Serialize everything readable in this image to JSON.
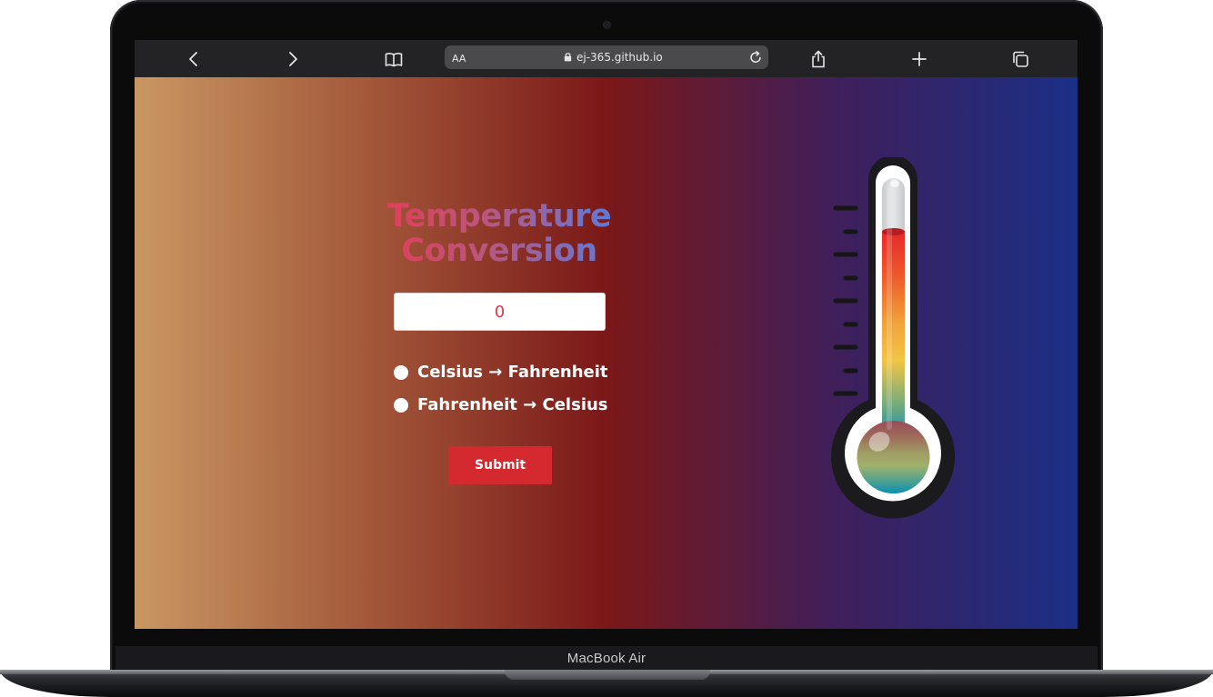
{
  "device": {
    "model_label": "MacBook Air"
  },
  "browser": {
    "text_size_label": "AA",
    "url": "ej-365.github.io",
    "icons": {
      "back": "chevron-left-icon",
      "forward": "chevron-right-icon",
      "bookmarks": "book-icon",
      "lock": "lock-icon",
      "reload": "reload-icon",
      "share": "share-icon",
      "new_tab": "plus-icon",
      "tabs": "tabs-icon"
    }
  },
  "app": {
    "title_line1": "Temperature",
    "title_line2": "Conversion",
    "input_value": "0",
    "options": [
      {
        "label": "Celsius → Fahrenheit",
        "selected": false
      },
      {
        "label": "Fahrenheit → Celsius",
        "selected": false
      }
    ],
    "submit_label": "Submit",
    "thermometer_icon": "thermometer-icon"
  },
  "colors": {
    "page_gradient": [
      "#c99762",
      "#a45a3b",
      "#7b1818",
      "#401f5a",
      "#1b2f86"
    ],
    "title_gradient": [
      "#ea3a4f",
      "#b9567f",
      "#4c82ea"
    ],
    "submit": "#d42a2f",
    "input_text": "#e0384c"
  }
}
